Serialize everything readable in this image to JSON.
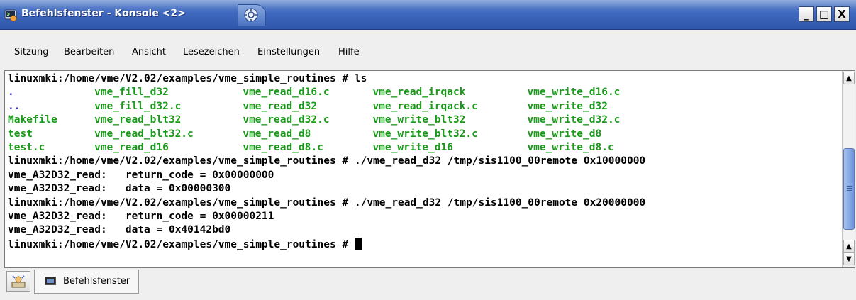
{
  "window": {
    "title": "Befehlsfenster - Konsole <2>",
    "minimize_label": "_",
    "maximize_label": "□",
    "close_label": "X"
  },
  "menu": {
    "items": [
      "Sitzung",
      "Bearbeiten",
      "Ansicht",
      "Lesezeichen",
      "Einstellungen",
      "Hilfe"
    ]
  },
  "terminal": {
    "colors": {
      "default": "#000000",
      "directory": "#3333cc",
      "executable": "#1a9a1a",
      "background": "#ffffff"
    },
    "lines": [
      [
        {
          "t": "linuxmki:/home/vme/V2.02/examples/vme_simple_routines # ls",
          "c": "default"
        }
      ],
      [
        {
          "t": ".",
          "c": "directory",
          "w": 14
        },
        {
          "t": "vme_fill_d32",
          "c": "executable",
          "w": 24
        },
        {
          "t": "vme_read_d16.c",
          "c": "executable",
          "w": 21
        },
        {
          "t": "vme_read_irqack",
          "c": "executable",
          "w": 25
        },
        {
          "t": "vme_write_d16.c",
          "c": "executable"
        }
      ],
      [
        {
          "t": "..",
          "c": "directory",
          "w": 14
        },
        {
          "t": "vme_fill_d32.c",
          "c": "executable",
          "w": 24
        },
        {
          "t": "vme_read_d32",
          "c": "executable",
          "w": 21
        },
        {
          "t": "vme_read_irqack.c",
          "c": "executable",
          "w": 25
        },
        {
          "t": "vme_write_d32",
          "c": "executable"
        }
      ],
      [
        {
          "t": "Makefile",
          "c": "executable",
          "w": 14
        },
        {
          "t": "vme_read_blt32",
          "c": "executable",
          "w": 24
        },
        {
          "t": "vme_read_d32.c",
          "c": "executable",
          "w": 21
        },
        {
          "t": "vme_write_blt32",
          "c": "executable",
          "w": 25
        },
        {
          "t": "vme_write_d32.c",
          "c": "executable"
        }
      ],
      [
        {
          "t": "test",
          "c": "executable",
          "w": 14
        },
        {
          "t": "vme_read_blt32.c",
          "c": "executable",
          "w": 24
        },
        {
          "t": "vme_read_d8",
          "c": "executable",
          "w": 21
        },
        {
          "t": "vme_write_blt32.c",
          "c": "executable",
          "w": 25
        },
        {
          "t": "vme_write_d8",
          "c": "executable"
        }
      ],
      [
        {
          "t": "test.c",
          "c": "executable",
          "w": 14
        },
        {
          "t": "vme_read_d16",
          "c": "executable",
          "w": 24
        },
        {
          "t": "vme_read_d8.c",
          "c": "executable",
          "w": 21
        },
        {
          "t": "vme_write_d16",
          "c": "executable",
          "w": 25
        },
        {
          "t": "vme_write_d8.c",
          "c": "executable"
        }
      ],
      [
        {
          "t": "linuxmki:/home/vme/V2.02/examples/vme_simple_routines # ./vme_read_d32 /tmp/sis1100_00remote 0x10000000",
          "c": "default"
        }
      ],
      [
        {
          "t": "vme_A32D32_read:   return_code = 0x00000000",
          "c": "default"
        }
      ],
      [
        {
          "t": "vme_A32D32_read:   data = 0x00000300",
          "c": "default"
        }
      ],
      [
        {
          "t": "linuxmki:/home/vme/V2.02/examples/vme_simple_routines # ./vme_read_d32 /tmp/sis1100_00remote 0x20000000",
          "c": "default"
        }
      ],
      [
        {
          "t": "vme_A32D32_read:   return_code = 0x00000211",
          "c": "default"
        }
      ],
      [
        {
          "t": "vme_A32D32_read:   data = 0x40142bd0",
          "c": "default"
        }
      ],
      [
        {
          "t": "linuxmki:/home/vme/V2.02/examples/vme_simple_routines # ",
          "c": "default",
          "cursor": true
        }
      ]
    ]
  },
  "scrollbar": {
    "up_arrow": "▲",
    "down_arrow_top": "▲",
    "down_arrow_bottom": "▼"
  },
  "tabs": [
    {
      "label": "Befehlsfenster"
    }
  ]
}
